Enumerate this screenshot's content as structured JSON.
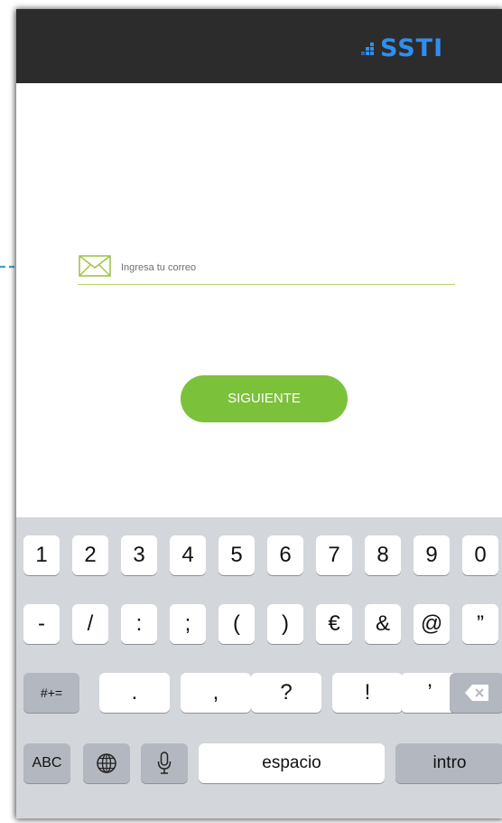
{
  "header": {
    "logo_text": "SSTI"
  },
  "form": {
    "email_placeholder": "Ingresa tu correo",
    "email_value": "",
    "next_button_label": "SIGUIENTE"
  },
  "keyboard": {
    "row1": [
      "1",
      "2",
      "3",
      "4",
      "5",
      "6",
      "7",
      "8",
      "9",
      "0"
    ],
    "row2": [
      "-",
      "/",
      ":",
      ";",
      "(",
      ")",
      "€",
      "&",
      "@",
      "”"
    ],
    "row3": {
      "shift_label": "#+=",
      "keys": [
        ".",
        ",",
        "?",
        "!",
        "’"
      ]
    },
    "row4": {
      "abc_label": "ABC",
      "space_label": "espacio",
      "return_label": "intro"
    }
  },
  "colors": {
    "header_bg": "#2c2c2c",
    "logo": "#2f8ff0",
    "accent_green": "#7cc13a",
    "underline": "#b7d36a",
    "arrow": "#3aa5c9",
    "keyboard_bg": "#d3d6db"
  },
  "icons": [
    "mail-icon",
    "globe-icon",
    "microphone-icon",
    "backspace-icon",
    "dashed-arrow-icon"
  ]
}
